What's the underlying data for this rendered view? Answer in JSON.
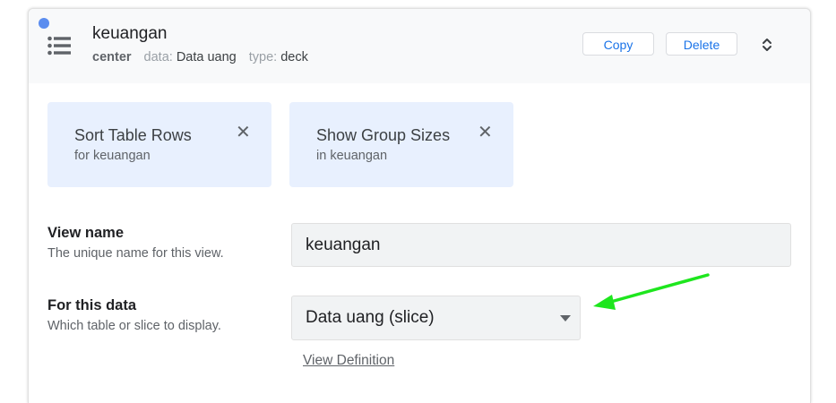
{
  "header": {
    "title": "keuangan",
    "position": "center",
    "data_key": "data:",
    "data_value": "Data uang",
    "type_key": "type:",
    "type_value": "deck",
    "copy_label": "Copy",
    "delete_label": "Delete",
    "status_dot_color": "#5b8def",
    "icon": "list-icon"
  },
  "actions": [
    {
      "title": "Sort Table Rows",
      "subtitle": "for keuangan",
      "close": "✕"
    },
    {
      "title": "Show Group Sizes",
      "subtitle": "in keuangan",
      "close": "✕"
    }
  ],
  "form": {
    "view_name": {
      "label": "View name",
      "help": "The unique name for this view.",
      "value": "keuangan"
    },
    "for_data": {
      "label": "For this data",
      "help": "Which table or slice to display.",
      "value": "Data uang (slice)",
      "link": "View Definition"
    }
  },
  "annotation": {
    "color": "#1ee61e"
  },
  "colors": {
    "accent": "#1a73e8",
    "action_card_bg": "#e8f0fe",
    "header_bg": "#f8f9fa"
  }
}
